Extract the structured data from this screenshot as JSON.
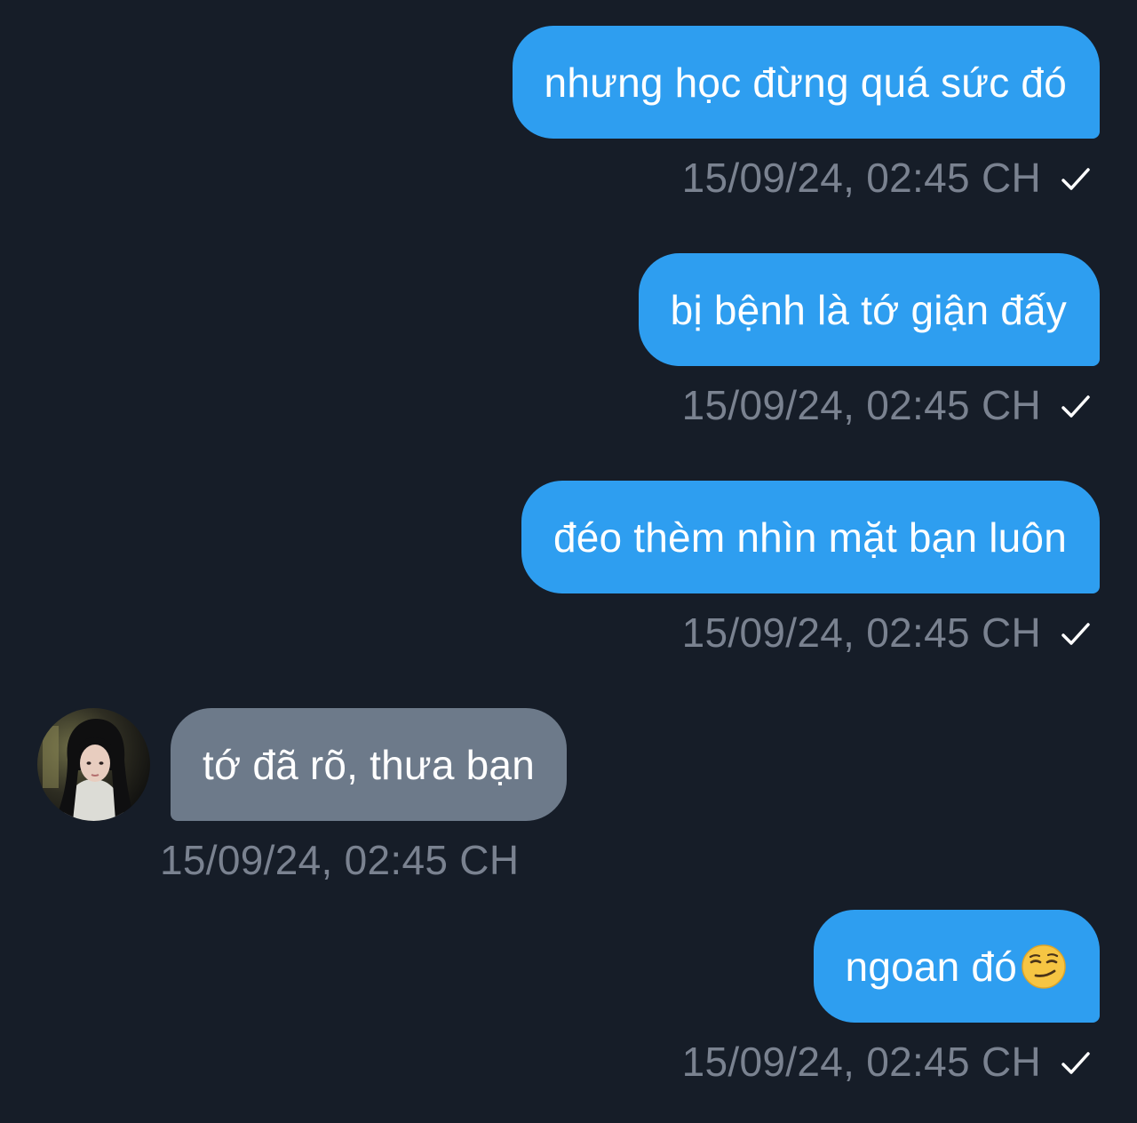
{
  "colors": {
    "background": "#161d28",
    "outgoing_bubble": "#2e9ef0",
    "incoming_bubble": "#6d7a8a",
    "timestamp": "#7a8290",
    "text": "#ffffff"
  },
  "messages": [
    {
      "direction": "outgoing",
      "text": "nhưng học đừng quá sức đó",
      "timestamp": "15/09/24, 02:45 CH",
      "status_icon": "check-icon"
    },
    {
      "direction": "outgoing",
      "text": "bị bệnh là tớ giận đấy",
      "timestamp": "15/09/24, 02:45 CH",
      "status_icon": "check-icon"
    },
    {
      "direction": "outgoing",
      "text": "đéo thèm nhìn mặt bạn luôn",
      "timestamp": "15/09/24, 02:45 CH",
      "status_icon": "check-icon"
    },
    {
      "direction": "incoming",
      "text": "tớ đã rõ, thưa bạn",
      "timestamp": "15/09/24, 02:45 CH",
      "avatar_icon": "contact-avatar"
    },
    {
      "direction": "outgoing",
      "text": "ngoan đó",
      "emoji": "smirking-face-icon",
      "timestamp": "15/09/24, 02:45 CH",
      "status_icon": "check-icon"
    }
  ]
}
